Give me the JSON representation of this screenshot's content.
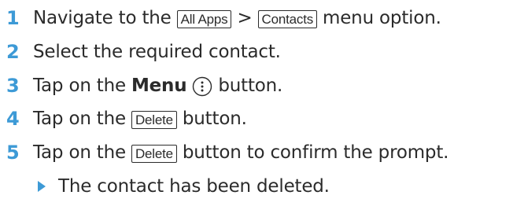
{
  "steps": [
    {
      "number": "1",
      "pre": "Navigate to the",
      "key_a": "All Apps",
      "sep": ">",
      "key_b": "Contacts",
      "post": "menu option."
    },
    {
      "number": "2",
      "text": "Select the required contact."
    },
    {
      "number": "3",
      "pre": "Tap on the",
      "bold": "Menu",
      "post": "button.",
      "icon": "vertical-ellipsis-icon"
    },
    {
      "number": "4",
      "pre": "Tap on the",
      "key": "Delete",
      "post": "button."
    },
    {
      "number": "5",
      "pre": "Tap on the",
      "key": "Delete",
      "post": "button to confirm the prompt."
    }
  ],
  "result": {
    "icon": "triangle-bullet-icon",
    "text": "The contact has been deleted."
  },
  "colors": {
    "accent": "#3d9ad6",
    "text": "#2b2b2b"
  }
}
